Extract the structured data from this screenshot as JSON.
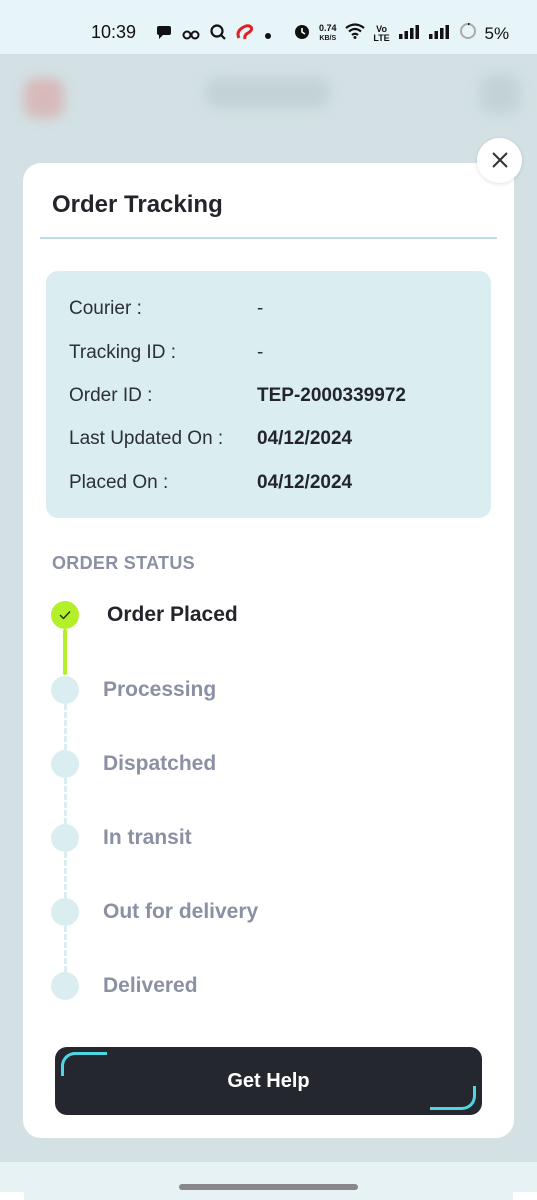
{
  "status_bar": {
    "time": "10:39",
    "net_speed_value": "0.74",
    "net_speed_unit": "KB/S",
    "network_label": "Vo LTE",
    "battery": "5%",
    "icons": [
      "chat-icon",
      "infinity-icon",
      "search-icon",
      "airtel-icon",
      "dot-icon",
      "alarm-icon",
      "wifi-icon",
      "signal-icon",
      "signal-icon",
      "battery-icon"
    ]
  },
  "modal": {
    "title": "Order Tracking",
    "close_icon": "close-icon",
    "info": [
      {
        "label": "Courier :",
        "value": "-",
        "bold": false
      },
      {
        "label": "Tracking ID :",
        "value": "-",
        "bold": false
      },
      {
        "label": "Order ID :",
        "value": "TEP-2000339972",
        "bold": true
      },
      {
        "label": "Last Updated On :",
        "value": "04/12/2024",
        "bold": true
      },
      {
        "label": "Placed On :",
        "value": "04/12/2024",
        "bold": true
      }
    ],
    "status_heading": "ORDER STATUS",
    "steps": [
      {
        "label": "Order Placed",
        "done": true
      },
      {
        "label": "Processing",
        "done": false
      },
      {
        "label": "Dispatched",
        "done": false
      },
      {
        "label": "In transit",
        "done": false
      },
      {
        "label": "Out for delivery",
        "done": false
      },
      {
        "label": "Delivered",
        "done": false
      }
    ],
    "help_button": "Get Help"
  },
  "colors": {
    "accent_green": "#b4f02a",
    "card_bg": "#daeef2",
    "dark_button": "#25272e",
    "button_accent": "#4fd6e4",
    "muted_text": "#8b90a3"
  }
}
